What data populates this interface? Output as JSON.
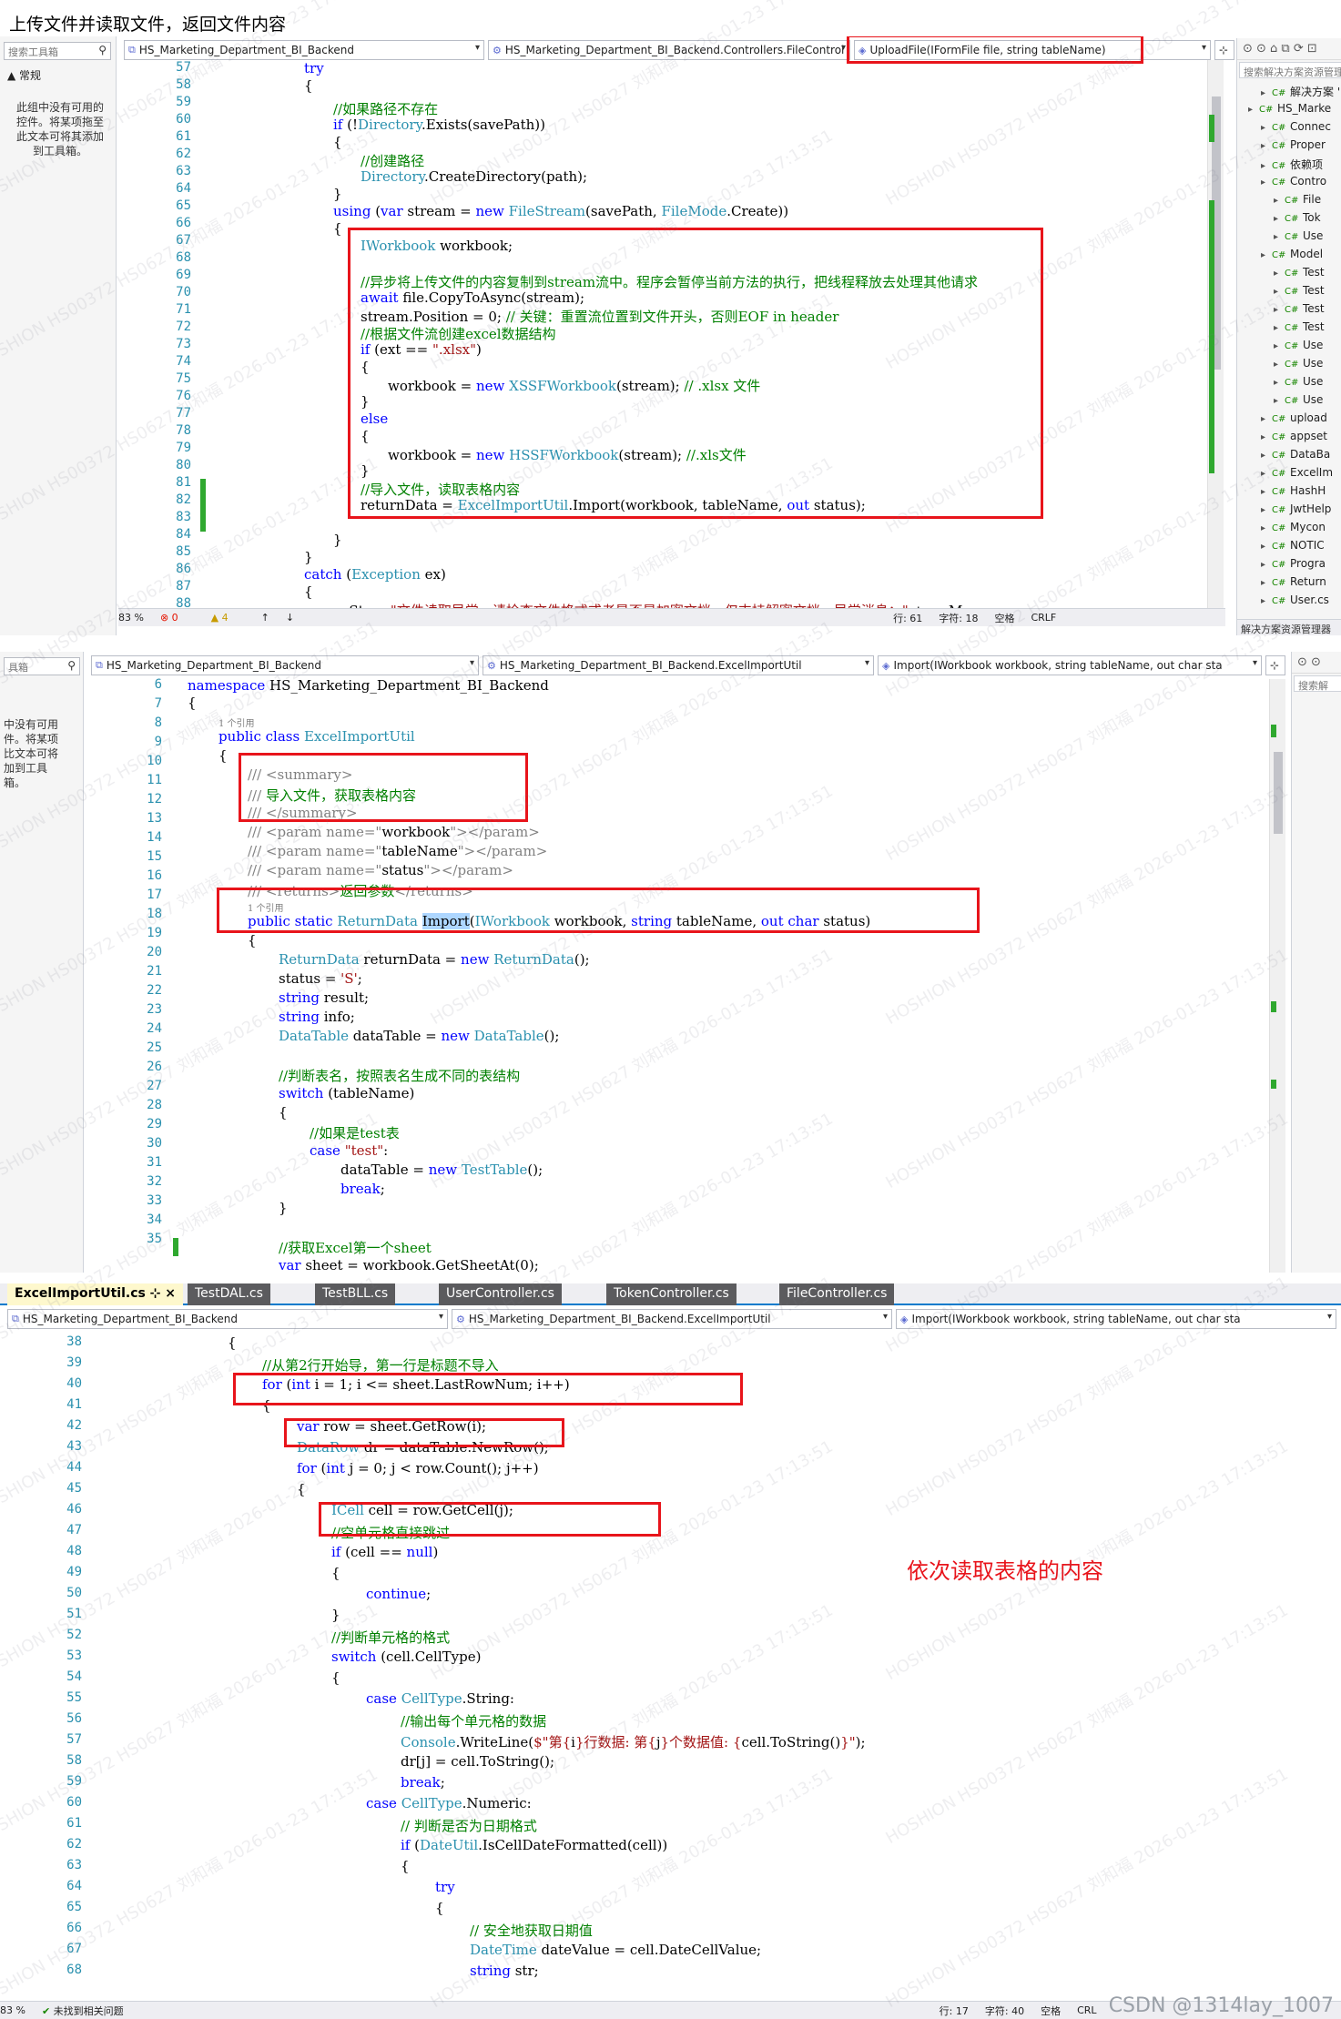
{
  "page_title": "上传文件并读取文件，返回文件内容",
  "panel1": {
    "toolbox": {
      "search_placeholder": "搜索工具箱",
      "section": "▲ 常规",
      "hint": "此组中没有可用的控件。将某项拖至此文本可将其添加到工具箱。"
    },
    "nav": {
      "project": "HS_Marketing_Department_BI_Backend",
      "class": "HS_Marketing_Department_BI_Backend.Controllers.FileControl",
      "member": "UploadFile(IFormFile file, string tableName)"
    },
    "lines": [
      "57",
      "58",
      "59",
      "60",
      "61",
      "62",
      "63",
      "64",
      "65",
      "66",
      "67",
      "68",
      "69",
      "70",
      "71",
      "72",
      "73",
      "74",
      "75",
      "76",
      "77",
      "78",
      "79",
      "80",
      "81",
      "82",
      "83",
      "84",
      "85",
      "86",
      "87",
      "88"
    ],
    "status": {
      "zoom": "83 %",
      "errors": "0",
      "warnings": "4",
      "line": "行: 61",
      "col": "字符: 18",
      "mode": "空格",
      "eol": "CRLF"
    },
    "solution": {
      "toolbar": "⊙ ⊙ ⌂ ⧉ ⟳ ⊡",
      "search": "搜索解决方案资源管理器",
      "items": [
        "解决方案 'HS_",
        "HS_Marke",
        "Connec",
        "Proper",
        "依赖项",
        "Contro",
        "File",
        "Tok",
        "Use",
        "Model",
        "Test",
        "Test",
        "Test",
        "Test",
        "Use",
        "Use",
        "Use",
        "Use",
        "upload",
        "appset",
        "DataBa",
        "ExcelIm",
        "HashH",
        "JwtHelp",
        "Mycon",
        "NOTIC",
        "Progra",
        "Return",
        "User.cs"
      ],
      "footer": "解决方案资源管理器"
    }
  },
  "panel2": {
    "toolbox": {
      "search_placeholder": "具箱",
      "hint": "中没有可用件。将某项比文本可将加到工具箱。"
    },
    "nav": {
      "project": "HS_Marketing_Department_BI_Backend",
      "class": "HS_Marketing_Department_BI_Backend.ExcelImportUtil",
      "member": "Import(IWorkbook workbook, string tableName, out char sta"
    },
    "lines": [
      "6",
      "7",
      "8",
      "9",
      "10",
      "11",
      "12",
      "13",
      "14",
      "15",
      "16",
      "17",
      "18",
      "19",
      "20",
      "21",
      "22",
      "23",
      "24",
      "25",
      "26",
      "27",
      "28",
      "29",
      "30",
      "31",
      "32",
      "33",
      "34",
      "35"
    ],
    "ref_count_1": "1 个引用",
    "ref_count_2": "1 个引用",
    "solution_search": "搜索解"
  },
  "panel3": {
    "tabs": [
      "ExcelImportUtil.cs",
      "TestDAL.cs",
      "TestBLL.cs",
      "UserController.cs",
      "TokenController.cs",
      "FileController.cs"
    ],
    "nav": {
      "project": "HS_Marketing_Department_BI_Backend",
      "class": "HS_Marketing_Department_BI_Backend.ExcelImportUtil",
      "member": "Import(IWorkbook workbook, string tableName, out char sta"
    },
    "lines": [
      "38",
      "39",
      "40",
      "41",
      "42",
      "43",
      "44",
      "45",
      "46",
      "47",
      "48",
      "49",
      "50",
      "51",
      "52",
      "53",
      "54",
      "55",
      "56",
      "57",
      "58",
      "59",
      "60",
      "61",
      "62",
      "63",
      "64",
      "65",
      "66",
      "67",
      "68"
    ],
    "annotation": "依次读取表格的内容",
    "status": {
      "zoom": "83 %",
      "issues": "未找到相关问题",
      "line": "行: 17",
      "col": "字符: 40",
      "mode": "空格",
      "eol": "CRL"
    }
  },
  "credit": "CSDN @1314lay_1007",
  "watermark": "HOSHION HS00372 HS0627 刘和福 2026-01-23 17:13:51",
  "colors": {
    "keyword": "#0000ff",
    "type": "#2b91af",
    "comment": "#008000",
    "string": "#a31515",
    "annotation_red": "#e8141b",
    "change_green": "#2fa82f"
  }
}
